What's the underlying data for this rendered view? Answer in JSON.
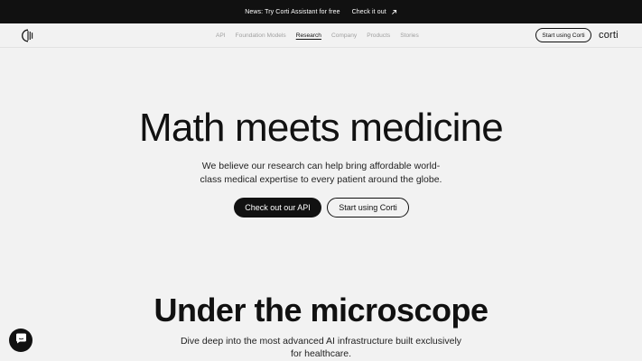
{
  "announcement": {
    "news_text": "News: Try Corti Assistant for free",
    "cta_label": "Check it out",
    "arrow_icon": "arrow-up-right-icon"
  },
  "nav": {
    "logo_icon": "corti-logo-icon",
    "links": [
      {
        "label": "API"
      },
      {
        "label": "Foundation Models"
      },
      {
        "label": "Research"
      },
      {
        "label": "Company"
      },
      {
        "label": "Products"
      },
      {
        "label": "Stories"
      }
    ],
    "active_link": "Research",
    "cta_label": "Start using Corti",
    "wordmark": "corti"
  },
  "hero": {
    "title": "Math meets medicine",
    "subtitle_line1": "We believe our research can help bring affordable world-",
    "subtitle_line2": "class medical expertise to every patient around the globe.",
    "primary_button": "Check out our API",
    "secondary_button": "Start using Corti"
  },
  "section": {
    "title": "Under the microscope",
    "subtitle_line1": "Dive deep into the most advanced AI infrastructure built exclusively",
    "subtitle_line2": "for healthcare."
  },
  "chat": {
    "icon": "chat-icon"
  },
  "colors": {
    "background": "#f2f2f2",
    "dark": "#111111",
    "muted_nav": "#a0a0a0"
  }
}
